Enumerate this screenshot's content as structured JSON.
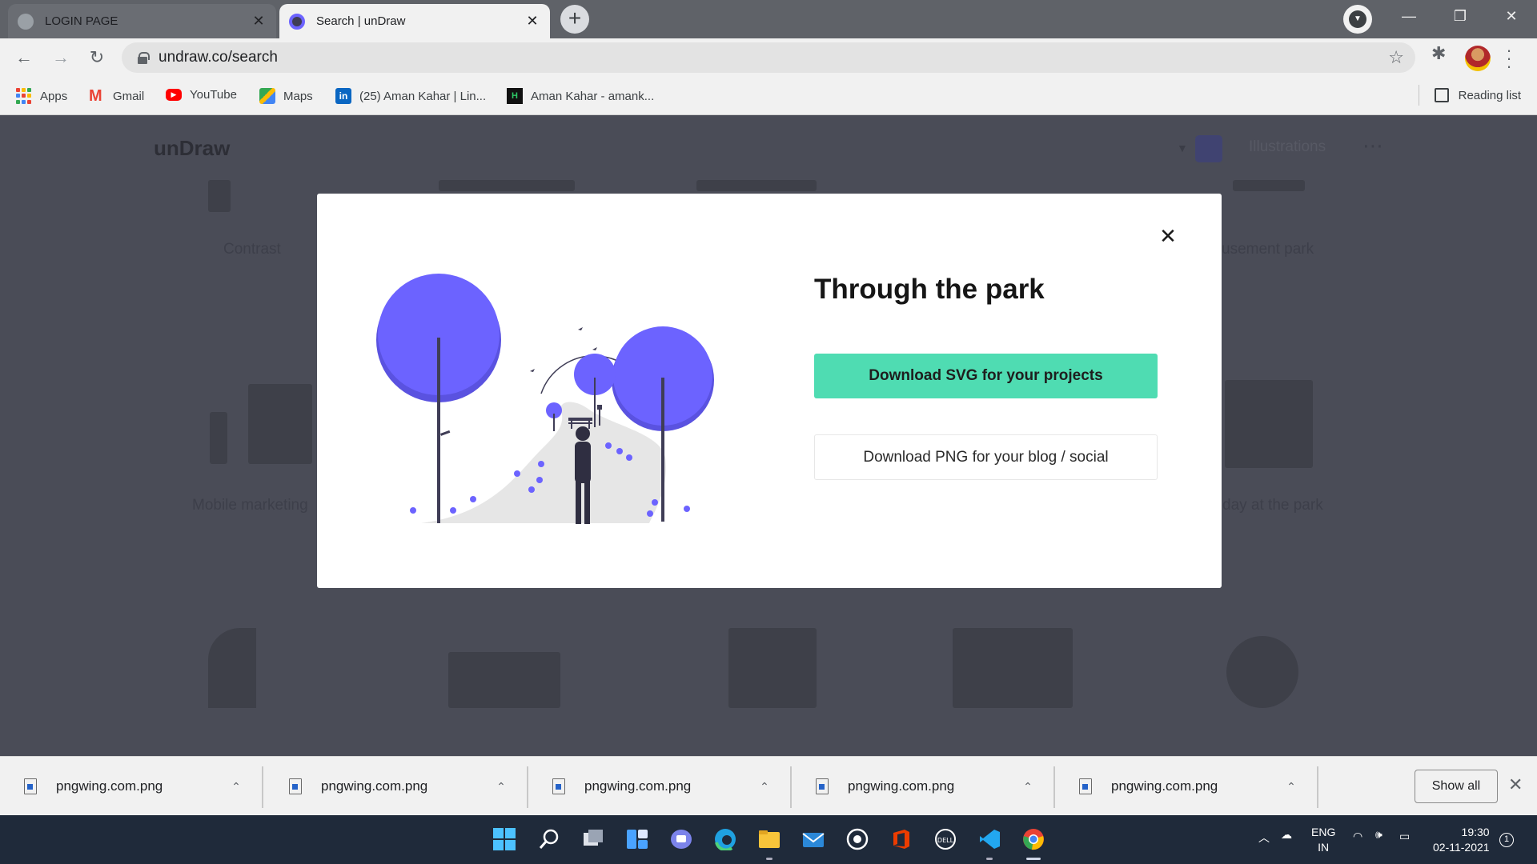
{
  "browser": {
    "tabs": [
      {
        "title": "LOGIN PAGE",
        "active": false
      },
      {
        "title": "Search | unDraw",
        "active": true
      }
    ],
    "url": "undraw.co/search",
    "bookmarks": [
      "Apps",
      "Gmail",
      "YouTube",
      "Maps",
      "(25) Aman Kahar | Lin...",
      "Aman Kahar - amank..."
    ],
    "reading_list": "Reading list"
  },
  "page_bg": {
    "logo": "unDraw",
    "nav_illustrations": "Illustrations",
    "labels": [
      "Contrast",
      "usement park",
      "Mobile marketing",
      "day at the park"
    ]
  },
  "modal": {
    "title": "Through the park",
    "svg_button": "Download SVG for your projects",
    "png_button": "Download PNG for your blog / social",
    "accent_color": "#6c63ff",
    "svg_button_color": "#4fdcb2"
  },
  "downloads": {
    "items": [
      "pngwing.com.png",
      "pngwing.com.png",
      "pngwing.com.png",
      "pngwing.com.png",
      "pngwing.com.png"
    ],
    "show_all": "Show all"
  },
  "taskbar": {
    "language": "ENG",
    "region": "IN",
    "time": "19:30",
    "date": "02-11-2021",
    "notifications": "1"
  }
}
